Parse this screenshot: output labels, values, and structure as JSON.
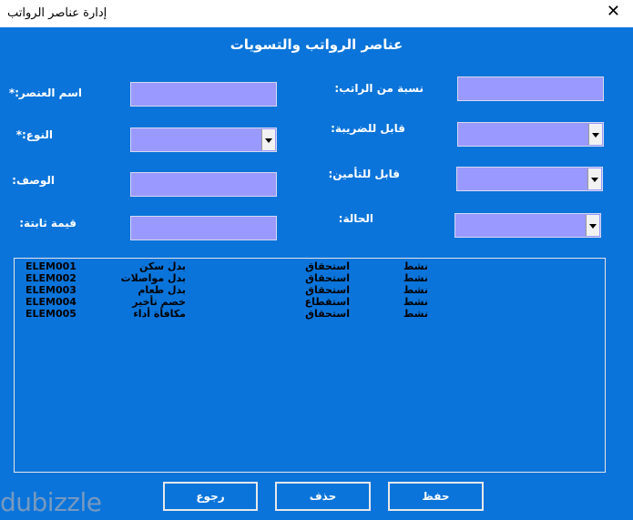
{
  "window": {
    "title": "إدارة عناصر الرواتب",
    "close_symbol": "✕"
  },
  "form": {
    "heading": "عناصر الرواتب والتسويات",
    "labels": {
      "element_name": "اسم العنصر:*",
      "type": "النوع:*",
      "description": "الوصف:",
      "fixed_value": "قيمة ثابتة:",
      "salary_percent": "نسبة من الراتب:",
      "taxable": "قابل للضريبة:",
      "insurable": "قابل للتأمين:",
      "status": "الحالة:"
    },
    "values": {
      "element_name": "",
      "description": "",
      "fixed_value": "",
      "salary_percent": "",
      "type": "",
      "taxable": "",
      "insurable": "",
      "status": ""
    }
  },
  "list": {
    "rows": [
      {
        "code": "ELEM001",
        "name": "بدل سكن",
        "kind": "استحقاق",
        "status": "نشط"
      },
      {
        "code": "ELEM002",
        "name": "بدل مواصلات",
        "kind": "استحقاق",
        "status": "نشط"
      },
      {
        "code": "ELEM003",
        "name": "بدل طعام",
        "kind": "استحقاق",
        "status": "نشط"
      },
      {
        "code": "ELEM004",
        "name": "خصم تأخير",
        "kind": "استقطاع",
        "status": "نشط"
      },
      {
        "code": "ELEM005",
        "name": "مكافأة أداء",
        "kind": "استحقاق",
        "status": "نشط"
      }
    ]
  },
  "buttons": {
    "back": "رجوع",
    "delete": "حذف",
    "save": "حفظ"
  },
  "watermark": "dubizzle",
  "colors": {
    "background": "#0a74da",
    "field": "#9999ff",
    "text": "#ffffff"
  }
}
